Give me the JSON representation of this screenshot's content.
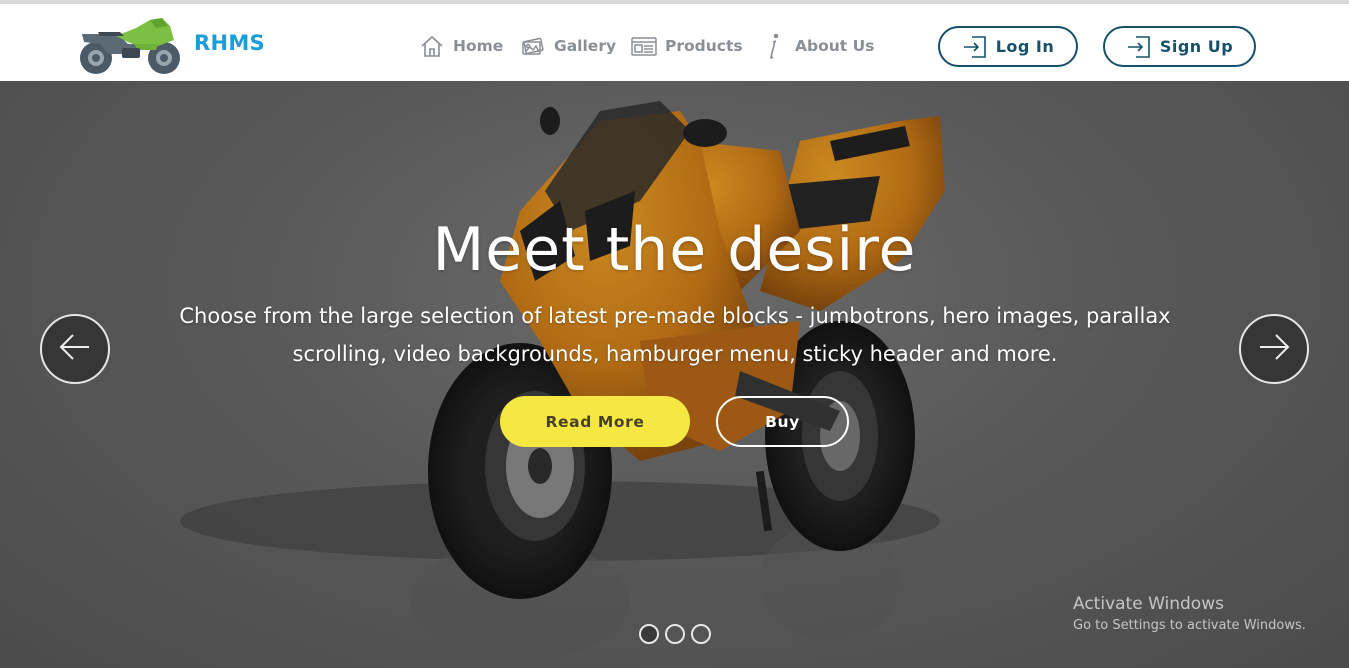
{
  "header": {
    "brand": "RHMS",
    "logo_icon": "motorcycle-logo-icon",
    "nav": [
      {
        "label": "Home",
        "icon": "home-icon"
      },
      {
        "label": "Gallery",
        "icon": "gallery-icon"
      },
      {
        "label": "Products",
        "icon": "products-icon"
      },
      {
        "label": "About Us",
        "icon": "info-icon"
      }
    ],
    "login_label": "Log In",
    "signup_label": "Sign Up"
  },
  "hero": {
    "title": "Meet the desire",
    "subtitle": "Choose from the large selection of latest pre-made blocks - jumbotrons, hero images, parallax scrolling, video backgrounds, hamburger menu, sticky header and more.",
    "read_more_label": "Read More",
    "buy_label": "Buy",
    "prev_icon": "arrow-left-icon",
    "next_icon": "arrow-right-icon",
    "slides_count": 3,
    "active_slide": 1
  },
  "watermark": {
    "title": "Activate Windows",
    "subtitle": "Go to Settings to activate Windows."
  },
  "colors": {
    "brand": "#1a9ed9",
    "nav_text": "#8a8f96",
    "button_border": "#17506a",
    "read_more_bg": "#f5e843",
    "bike_orange": "#e08a10"
  }
}
